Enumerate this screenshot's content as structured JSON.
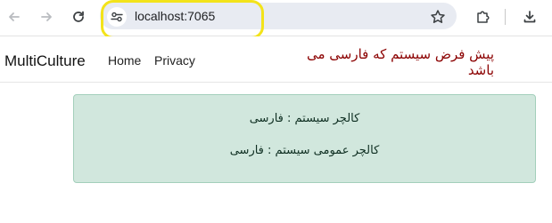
{
  "browser": {
    "url": "localhost:7065",
    "icons": {
      "back": "back-arrow-icon",
      "forward": "forward-arrow-icon",
      "reload": "reload-icon",
      "site_info": "site-info-icon",
      "bookmark": "star-icon",
      "extensions": "puzzle-icon",
      "downloads": "download-icon"
    },
    "highlight_color": "#f3e31a"
  },
  "navbar": {
    "brand": "MultiCulture",
    "links": [
      "Home",
      "Privacy"
    ],
    "banner": "پیش فرض سیستم که فارسی می باشد",
    "banner_color": "#8b0000"
  },
  "alert": {
    "line1": "کالچر سیستم : فارسی",
    "line2": "کالچر عمومی سیستم : فارسی",
    "background": "#d1e7dd",
    "border": "#a3cfbb"
  }
}
